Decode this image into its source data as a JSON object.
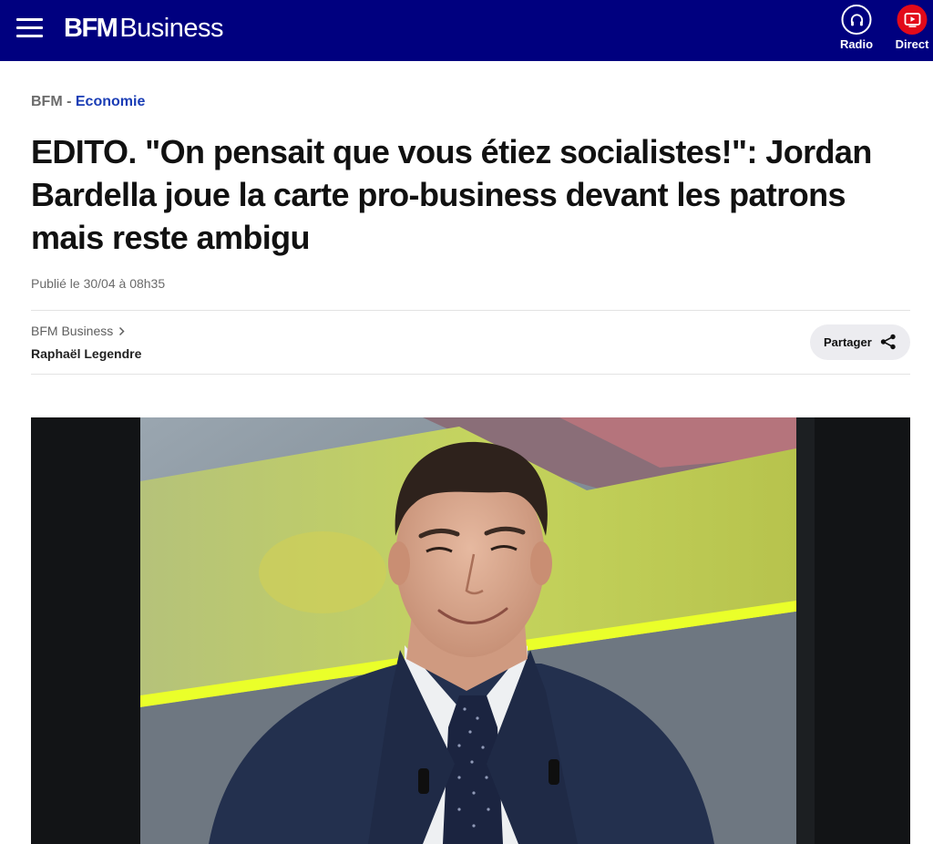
{
  "header": {
    "logo_bold": "BFM",
    "logo_regular": "Business",
    "radio_label": "Radio",
    "direct_label": "Direct",
    "menu_icon": "hamburger-menu-icon",
    "radio_icon": "headphones-icon",
    "direct_icon": "play-icon",
    "background_color": "#00007f",
    "direct_color": "#e20a1a"
  },
  "breadcrumb": {
    "site": "BFM",
    "separator": " - ",
    "section": "Economie",
    "section_color": "#1a3db5"
  },
  "article": {
    "title": "EDITO. \"On pensait que vous étiez socialistes!\": Jordan Bardella joue la carte pro-business devant les patrons mais reste ambigu",
    "published": "Publié le 30/04 à 08h35",
    "source": "BFM Business",
    "author": "Raphaël Legendre",
    "share_label": "Partager",
    "share_icon": "share-icon"
  }
}
